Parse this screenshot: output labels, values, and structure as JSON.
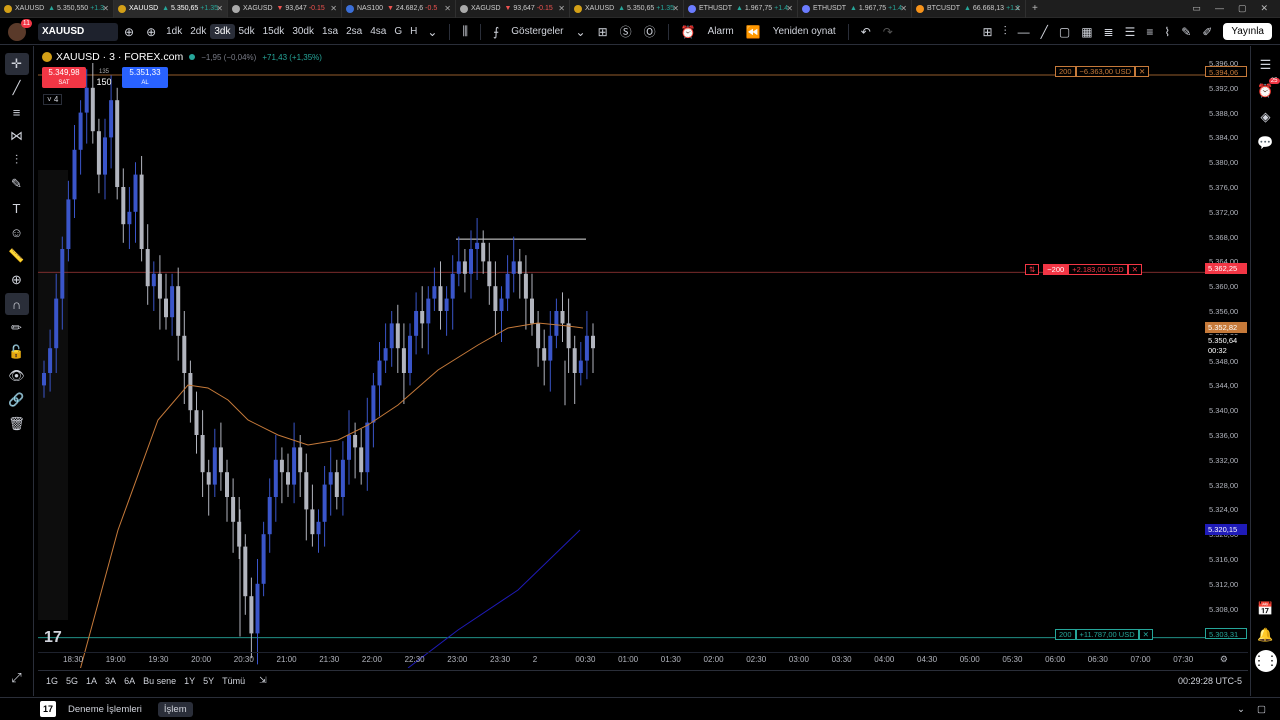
{
  "browser_tabs": [
    {
      "title": "XAUUSD",
      "price": "5.350,550",
      "change": "+1.3",
      "dir": "up",
      "icon": "gold"
    },
    {
      "title": "XAUUSD",
      "price": "5.350,65",
      "change": "+1.35",
      "dir": "up",
      "icon": "gold",
      "active": true
    },
    {
      "title": "XAGUSD",
      "price": "93,647",
      "change": "-0.15",
      "dir": "dn",
      "icon": "silver"
    },
    {
      "title": "NAS100",
      "price": "24.682,6",
      "change": "-0.5",
      "dir": "dn",
      "icon": "nas"
    },
    {
      "title": "XAGUSD",
      "price": "93,647",
      "change": "-0.15",
      "dir": "dn",
      "icon": "silver"
    },
    {
      "title": "XAUUSD",
      "price": "5.350,65",
      "change": "+1.35",
      "dir": "up",
      "icon": "gold"
    },
    {
      "title": "ETHUSDT",
      "price": "1.967,75",
      "change": "+1.4",
      "dir": "up",
      "icon": "eth"
    },
    {
      "title": "ETHUSDT",
      "price": "1.967,75",
      "change": "+1.4",
      "dir": "up",
      "icon": "eth"
    },
    {
      "title": "BTCUSDT",
      "price": "66.668,13",
      "change": "+1.1",
      "dir": "up",
      "icon": "btc"
    }
  ],
  "toolbar": {
    "avatar_badge": "11",
    "symbol": "XAUUSD",
    "intervals": [
      "1dk",
      "2dk",
      "3dk",
      "5dk",
      "15dk",
      "30dk",
      "1sa",
      "2sa",
      "4sa",
      "G",
      "H"
    ],
    "active_interval": "3dk",
    "indicators_label": "Göstergeler",
    "alarm_label": "Alarm",
    "replay_label": "Yeniden oynat",
    "publish_label": "Yayınla"
  },
  "legend": {
    "title": "XAUUSD · 3 · FOREX.com",
    "change": "−1,95 (−0,04%)",
    "change2": "+71,43 (+1,35%)",
    "sell_price": "5.349,98",
    "sell_label": "SAT",
    "spread": "135",
    "quantity": "150",
    "buy_price": "5.351,33",
    "buy_label": "AL",
    "indicator_count": "4"
  },
  "price_axis": {
    "ticks": [
      "5.396,00",
      "5.392,00",
      "5.388,00",
      "5.384,00",
      "5.380,00",
      "5.376,00",
      "5.372,00",
      "5.368,00",
      "5.364,00",
      "5.360,00",
      "5.356,00",
      "5.352,00",
      "5.348,00",
      "5.344,00",
      "5.340,00",
      "5.336,00",
      "5.332,00",
      "5.328,00",
      "5.324,00",
      "5.320,00",
      "5.316,00",
      "5.312,00",
      "5.308,00"
    ],
    "tags": {
      "top_position": "5.394,06",
      "sell_position": "5.362,25",
      "ma": "5.352,82",
      "last_price": "5.350,64",
      "countdown": "00:32",
      "blue_line": "5.320,15",
      "bottom_position": "5.303,31"
    }
  },
  "positions": {
    "top": {
      "qty": "200",
      "pnl": "−6.363,00 USD"
    },
    "middle": {
      "qty": "−200",
      "pnl": "+2.183,00 USD"
    },
    "bottom": {
      "qty": "200",
      "pnl": "+11.787,00 USD"
    }
  },
  "time_axis": [
    "18:30",
    "19:00",
    "19:30",
    "20:00",
    "20:30",
    "21:00",
    "21:30",
    "22:00",
    "22:30",
    "23:00",
    "23:30",
    "2",
    "00:30",
    "01:00",
    "01:30",
    "02:00",
    "02:30",
    "03:00",
    "03:30",
    "04:00",
    "04:30",
    "05:00",
    "05:30",
    "06:00",
    "06:30",
    "07:00",
    "07:30"
  ],
  "range_bar": {
    "ranges": [
      "1G",
      "5G",
      "1A",
      "3A",
      "6A",
      "Bu sene",
      "1Y",
      "5Y",
      "Tümü"
    ],
    "clock": "00:29:28 UTC-5"
  },
  "bottom_bar": {
    "tvlogo": "17",
    "paper_trading": "Deneme İşlemleri",
    "trade": "İşlem"
  },
  "colors": {
    "up_candle": "#3a55c9",
    "down_candle": "#b2b5be",
    "sell": "#f23645",
    "buy": "#2962ff",
    "ma": "#c67a3a",
    "position_up": "#26a69a"
  }
}
